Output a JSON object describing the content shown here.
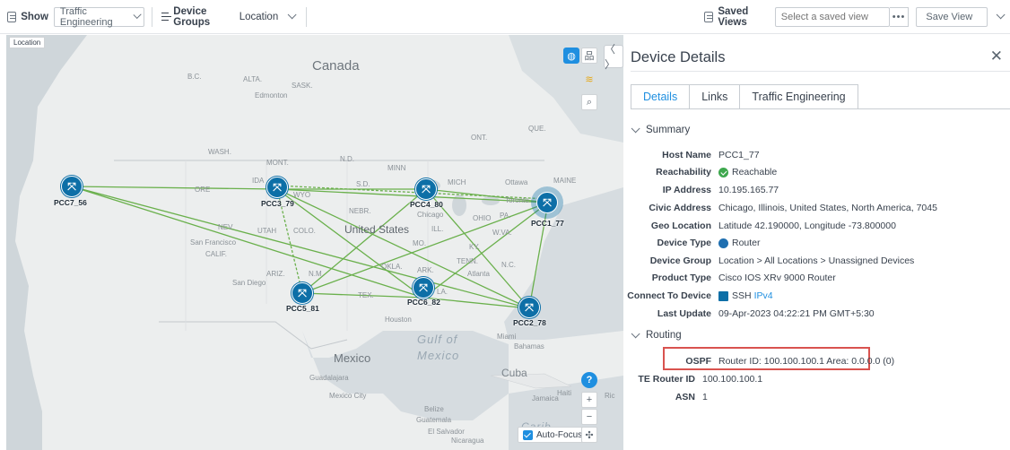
{
  "toolbar": {
    "show_label": "Show",
    "show_value": "Traffic Engineering",
    "device_groups_label": "Device Groups",
    "location_value": "Location",
    "saved_views_label": "Saved Views",
    "saved_view_placeholder": "Select a saved view",
    "more_label": "•••",
    "save_view_label": "Save View"
  },
  "map": {
    "location_tag": "Location",
    "labels": {
      "canada": "Canada",
      "alta": "ALTA.",
      "sask": "SASK.",
      "bc": "B.C.",
      "edmonton": "Edmonton",
      "wash": "WASH.",
      "mont": "MONT.",
      "nd": "N.D.",
      "minn": "MINN",
      "ont": "ONT.",
      "que": "QUE.",
      "ore": "ORE",
      "ida": "IDA",
      "wyo": "WYO",
      "sd": "S.D.",
      "mich": "MICH",
      "ottawa": "Ottawa",
      "maine": "MAINE",
      "toronto": "Toronto",
      "nebr": "NEBR.",
      "chicago": "Chicago",
      "ohio": "OHIO",
      "pa": "PA.",
      "nev": "NEV.",
      "utah": "UTAH",
      "colo": "COLO.",
      "united_states": "United States",
      "ill": "ILL.",
      "wva": "W.VA.",
      "san_francisco": "San Francisco",
      "calif": "CALIF.",
      "okla": "OKLA.",
      "ark": "ARK.",
      "tenn": "TENN.",
      "nc": "N.C.",
      "ky": "KY.",
      "mo": "MO.",
      "ariz": "ARIZ.",
      "nm": "N.M.",
      "atlanta": "Atlanta",
      "san_diego": "San Diego",
      "tex": "TEX.",
      "la": "LA.",
      "houston": "Houston",
      "gulf": "Gulf of",
      "mexico_water": "Mexico",
      "miami": "Miami",
      "bahamas": "Bahamas",
      "mexico": "Mexico",
      "guadalajara": "Guadalajara",
      "mexico_city": "Mexico City",
      "cuba": "Cuba",
      "jamaica": "Jamaica",
      "haiti": "Haiti",
      "belize": "Belize",
      "guatemala": "Guatemala",
      "el_salvador": "El Salvador",
      "nicaragua": "Nicaragua",
      "carib": "Carib",
      "ric": "Ric"
    },
    "nodes": [
      {
        "id": "PCC7_56",
        "label": "PCC7_56"
      },
      {
        "id": "PCC3_79",
        "label": "PCC3_79"
      },
      {
        "id": "PCC4_80",
        "label": "PCC4_80"
      },
      {
        "id": "PCC1_77",
        "label": "PCC1_77"
      },
      {
        "id": "PCC5_81",
        "label": "PCC5_81"
      },
      {
        "id": "PCC6_82",
        "label": "PCC6_82"
      },
      {
        "id": "PCC2_78",
        "label": "PCC2_78"
      }
    ],
    "node_glyph": "⤧",
    "autofocus_label": "Auto-Focus",
    "zoom_in": "+",
    "zoom_out": "−",
    "help": "?",
    "link_color": "#6ab04c",
    "node_color": "#0d6fa7"
  },
  "panel": {
    "title": "Device Details",
    "close": "✕",
    "collapse": "〈 〉",
    "tabs": [
      "Details",
      "Links",
      "Traffic Engineering"
    ],
    "summary": {
      "heading": "Summary",
      "host_name_k": "Host Name",
      "host_name_v": "PCC1_77",
      "reachability_k": "Reachability",
      "reachability_v": "Reachable",
      "ip_k": "IP Address",
      "ip_v": "10.195.165.77",
      "civic_k": "Civic Address",
      "civic_v": "Chicago, Illinois, United States, North America, 7045",
      "geo_k": "Geo Location",
      "geo_v": "Latitude 42.190000, Longitude -73.800000",
      "type_k": "Device Type",
      "type_v": "Router",
      "group_k": "Device Group",
      "group_v": "Location > All Locations > Unassigned Devices",
      "product_k": "Product Type",
      "product_v": "Cisco IOS XRv 9000 Router",
      "connect_k": "Connect To Device",
      "connect_v": "SSH",
      "connect_link": "IPv4",
      "update_k": "Last Update",
      "update_v": "09-Apr-2023 04:22:21 PM GMT+5:30"
    },
    "routing": {
      "heading": "Routing",
      "ospf_k": "OSPF",
      "ospf_v": "Router ID: 100.100.100.1 Area: 0.0.0.0 (0)",
      "te_k": "TE Router ID",
      "te_v": "100.100.100.1",
      "asn_k": "ASN",
      "asn_v": "1"
    }
  }
}
